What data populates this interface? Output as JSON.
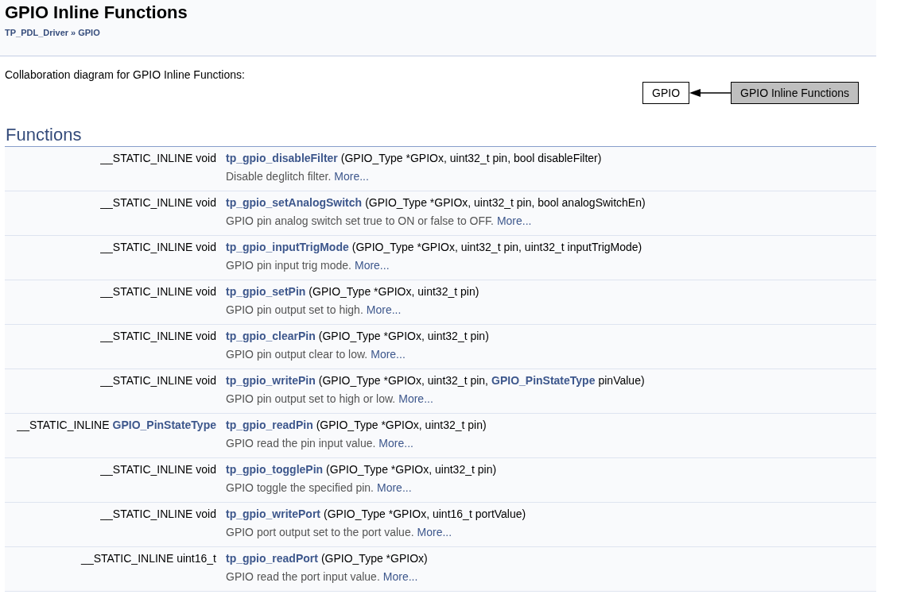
{
  "header": {
    "title": "GPIO Inline Functions",
    "breadcrumb": [
      {
        "label": "TP_PDL_Driver"
      },
      {
        "label": "GPIO"
      }
    ],
    "separator": "»"
  },
  "collaboration": {
    "caption": "Collaboration diagram for GPIO Inline Functions:",
    "nodes": [
      {
        "label": "GPIO",
        "selected": false
      },
      {
        "label": "GPIO Inline Functions",
        "selected": true
      }
    ]
  },
  "functions": {
    "heading": "Functions",
    "rows": [
      {
        "ret": [
          {
            "kind": "text",
            "text": "__STATIC_INLINE void"
          }
        ],
        "name": "tp_gpio_disableFilter",
        "args": [
          {
            "kind": "text",
            "text": "(GPIO_Type *GPIOx, uint32_t pin, bool disableFilter)"
          }
        ],
        "brief": "Disable deglitch filter.",
        "more": "More..."
      },
      {
        "ret": [
          {
            "kind": "text",
            "text": "__STATIC_INLINE void"
          }
        ],
        "name": "tp_gpio_setAnalogSwitch",
        "args": [
          {
            "kind": "text",
            "text": "(GPIO_Type *GPIOx, uint32_t pin, bool analogSwitchEn)"
          }
        ],
        "brief": "GPIO pin analog switch set true to ON or false to OFF.",
        "more": "More..."
      },
      {
        "ret": [
          {
            "kind": "text",
            "text": "__STATIC_INLINE void"
          }
        ],
        "name": "tp_gpio_inputTrigMode",
        "args": [
          {
            "kind": "text",
            "text": "(GPIO_Type *GPIOx, uint32_t pin, uint32_t inputTrigMode)"
          }
        ],
        "brief": "GPIO pin input trig mode.",
        "more": "More..."
      },
      {
        "ret": [
          {
            "kind": "text",
            "text": "__STATIC_INLINE void"
          }
        ],
        "name": "tp_gpio_setPin",
        "args": [
          {
            "kind": "text",
            "text": "(GPIO_Type *GPIOx, uint32_t pin)"
          }
        ],
        "brief": "GPIO pin output set to high.",
        "more": "More..."
      },
      {
        "ret": [
          {
            "kind": "text",
            "text": "__STATIC_INLINE void"
          }
        ],
        "name": "tp_gpio_clearPin",
        "args": [
          {
            "kind": "text",
            "text": "(GPIO_Type *GPIOx, uint32_t pin)"
          }
        ],
        "brief": "GPIO pin output clear to low.",
        "more": "More..."
      },
      {
        "ret": [
          {
            "kind": "text",
            "text": "__STATIC_INLINE void"
          }
        ],
        "name": "tp_gpio_writePin",
        "args": [
          {
            "kind": "text",
            "text": "(GPIO_Type *GPIOx, uint32_t pin,"
          },
          {
            "kind": "link",
            "text": "GPIO_PinStateType"
          },
          {
            "kind": "text",
            "text": "pinValue)"
          }
        ],
        "brief": "GPIO pin output set to high or low.",
        "more": "More..."
      },
      {
        "ret": [
          {
            "kind": "text",
            "text": "__STATIC_INLINE"
          },
          {
            "kind": "link",
            "text": "GPIO_PinStateType"
          }
        ],
        "name": "tp_gpio_readPin",
        "args": [
          {
            "kind": "text",
            "text": "(GPIO_Type *GPIOx, uint32_t pin)"
          }
        ],
        "brief": "GPIO read the pin input value.",
        "more": "More..."
      },
      {
        "ret": [
          {
            "kind": "text",
            "text": "__STATIC_INLINE void"
          }
        ],
        "name": "tp_gpio_togglePin",
        "args": [
          {
            "kind": "text",
            "text": "(GPIO_Type *GPIOx, uint32_t pin)"
          }
        ],
        "brief": "GPIO toggle the specified pin.",
        "more": "More..."
      },
      {
        "ret": [
          {
            "kind": "text",
            "text": "__STATIC_INLINE void"
          }
        ],
        "name": "tp_gpio_writePort",
        "args": [
          {
            "kind": "text",
            "text": "(GPIO_Type *GPIOx, uint16_t portValue)"
          }
        ],
        "brief": "GPIO port output set to the port value.",
        "more": "More..."
      },
      {
        "ret": [
          {
            "kind": "text",
            "text": "__STATIC_INLINE uint16_t"
          }
        ],
        "name": "tp_gpio_readPort",
        "args": [
          {
            "kind": "text",
            "text": "(GPIO_Type *GPIOx)"
          }
        ],
        "brief": "GPIO read the port input value.",
        "more": "More..."
      }
    ]
  }
}
